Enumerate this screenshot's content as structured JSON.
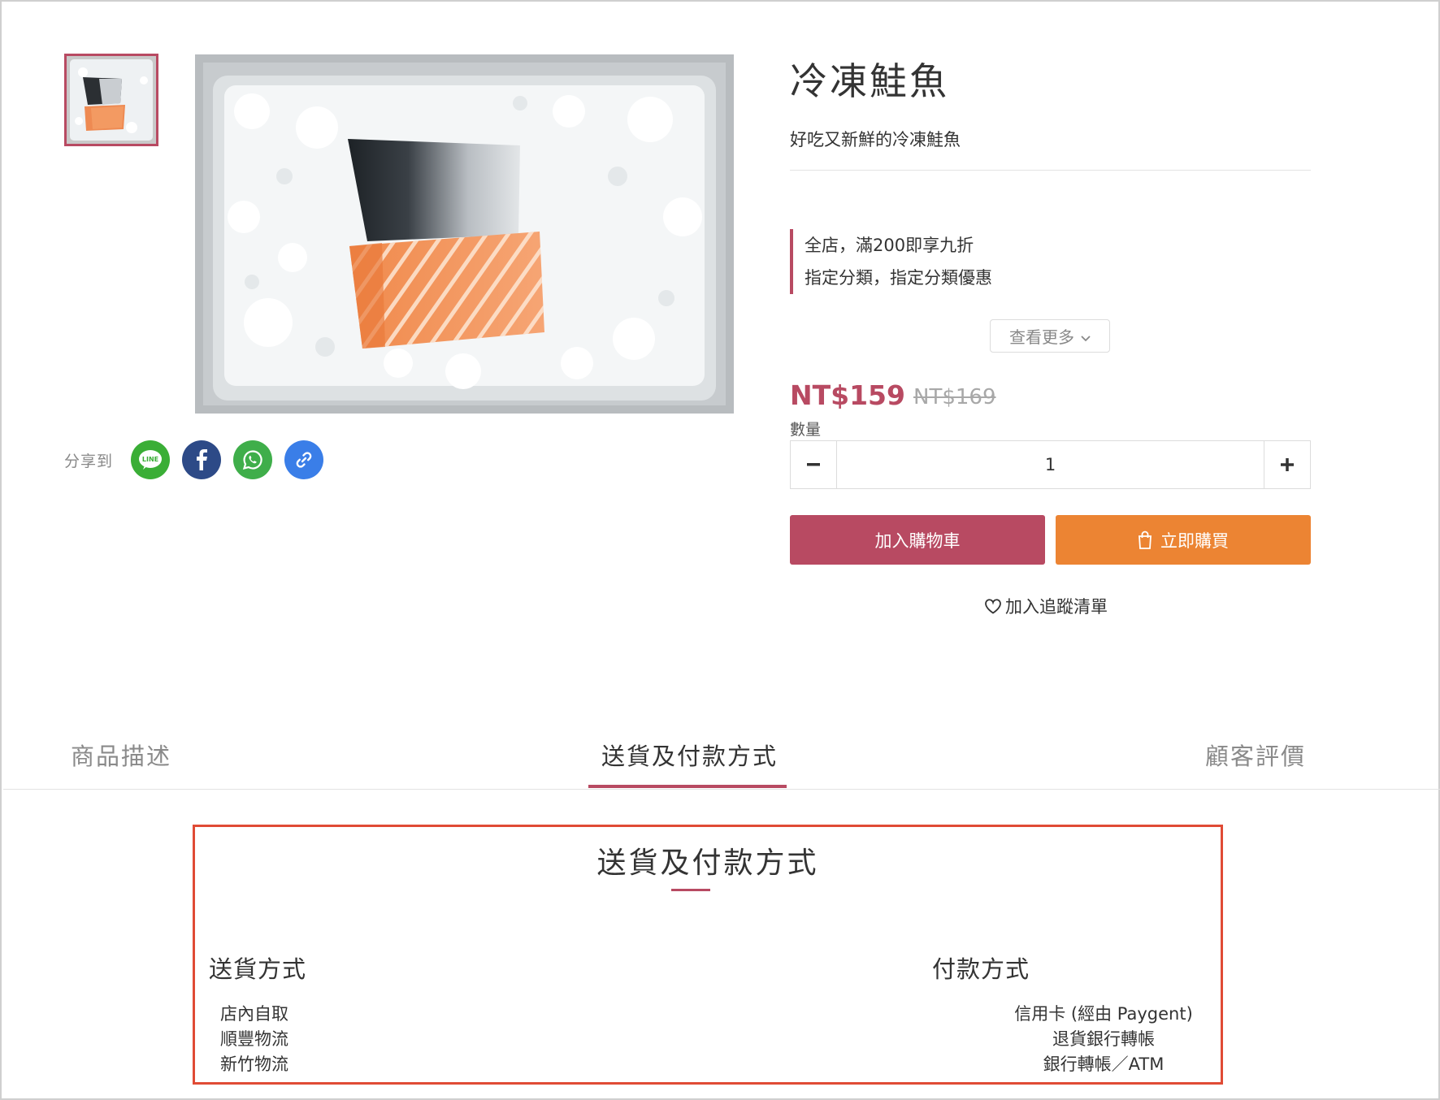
{
  "product": {
    "title": "冷凍鮭魚",
    "subtitle": "好吃又新鮮的冷凍鮭魚",
    "promotions": [
      "全店，滿200即享九折",
      "指定分類，指定分類優惠"
    ],
    "more_label": "查看更多",
    "price": "NT$159",
    "original_price": "NT$169",
    "quantity_label": "數量",
    "quantity_value": "1",
    "add_to_cart_label": "加入購物車",
    "buy_now_label": "立即購買",
    "wishlist_label": "加入追蹤清單"
  },
  "share": {
    "label": "分享到",
    "buttons": [
      {
        "name": "line-icon",
        "text": "LINE",
        "color": "#3aae36"
      },
      {
        "name": "facebook-icon",
        "color": "#2d4a87"
      },
      {
        "name": "whatsapp-icon",
        "color": "#3fae4a"
      },
      {
        "name": "link-icon",
        "color": "#3a7ee8"
      }
    ]
  },
  "tabs": [
    {
      "label": "商品描述",
      "active": false
    },
    {
      "label": "送貨及付款方式",
      "active": true
    },
    {
      "label": "顧客評價",
      "active": false
    }
  ],
  "delivery_payment": {
    "title": "送貨及付款方式",
    "shipping_heading": "送貨方式",
    "shipping_methods": [
      "店內自取",
      "順豐物流",
      "新竹物流"
    ],
    "payment_heading": "付款方式",
    "payment_methods": [
      "信用卡 (經由 Paygent)",
      "退貨銀行轉帳",
      "銀行轉帳／ATM"
    ]
  },
  "colors": {
    "accent": "#b84a62",
    "buy_now": "#ec8433",
    "highlight_box": "#e04b35"
  }
}
